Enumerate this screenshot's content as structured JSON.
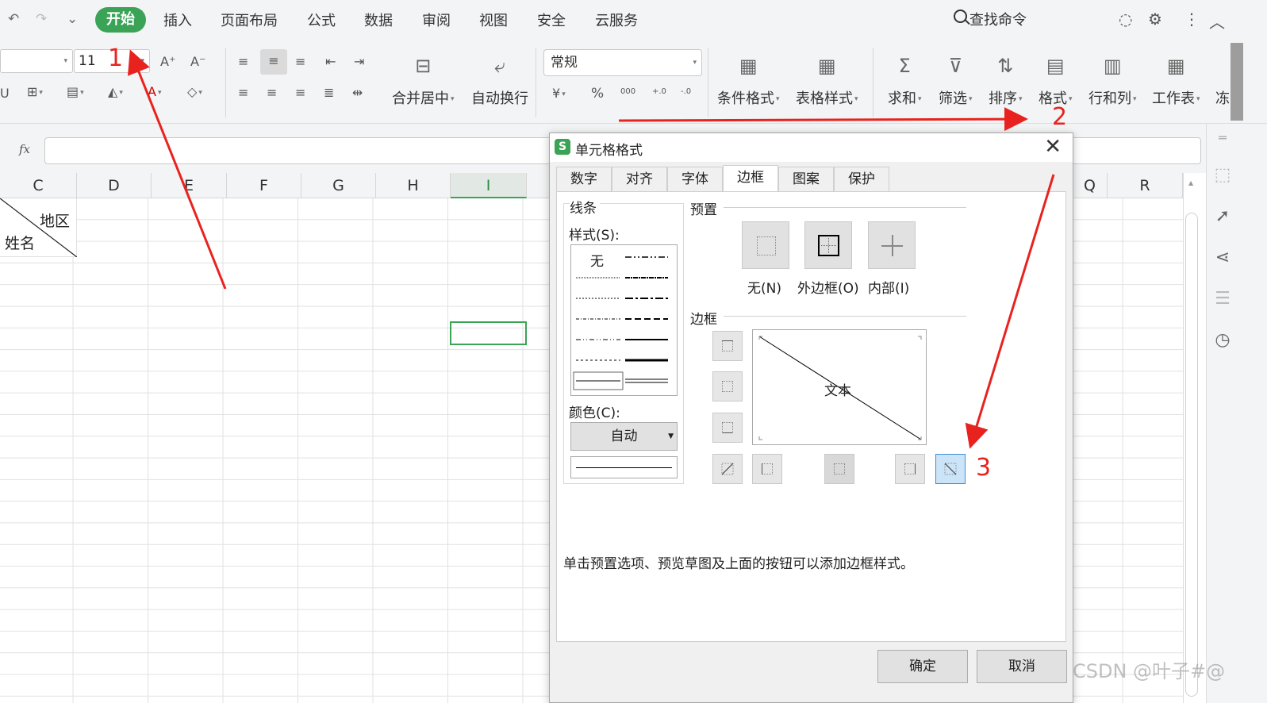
{
  "quick_access": {
    "undo": "↶",
    "redo": "↷",
    "more": "⌄"
  },
  "menu": {
    "active": "开始",
    "items": [
      "插入",
      "页面布局",
      "公式",
      "数据",
      "审阅",
      "视图",
      "安全",
      "云服务"
    ],
    "command_search": "查找命令"
  },
  "ribbon": {
    "font_size": "11",
    "number_format": "常规",
    "merge_center": "合并居中",
    "wrap_text": "自动换行",
    "conditional_format": "条件格式",
    "table_style": "表格样式",
    "sum": "求和",
    "filter": "筛选",
    "sort": "排序",
    "format": "格式",
    "rows_cols": "行和列",
    "worksheet": "工作表",
    "truncated": "冻",
    "percent": "%",
    "currency": "¥",
    "thousands": "000",
    "dec_inc": "+.0",
    "dec_dec": "-.0"
  },
  "formula_bar": {
    "fx": "fx"
  },
  "sheet": {
    "columns": [
      "C",
      "D",
      "E",
      "F",
      "G",
      "H",
      "I",
      "Q",
      "R"
    ],
    "cell_C1": {
      "top_right": "地区",
      "bottom_left": "姓名"
    }
  },
  "dialog": {
    "title": "单元格格式",
    "tabs": [
      "数字",
      "对齐",
      "字体",
      "边框",
      "图案",
      "保护"
    ],
    "active_tab": "边框",
    "lines_group": "线条",
    "style_label": "样式(S):",
    "style_none": "无",
    "color_label": "颜色(C):",
    "color_value": "自动",
    "presets_group": "预置",
    "preset_none": "无(N)",
    "preset_outline": "外边框(O)",
    "preset_inside": "内部(I)",
    "border_group": "边框",
    "preview_text": "文本",
    "hint": "单击预置选项、预览草图及上面的按钮可以添加边框样式。",
    "ok": "确定",
    "cancel": "取消"
  },
  "annotations": {
    "step1": "1",
    "step2": "2",
    "step3": "3"
  },
  "watermark": "CSDN @叶子#@",
  "colors": {
    "accent_green": "#3aa356",
    "annotation_red": "#e8231f",
    "selected_blue": "#cce4f7"
  }
}
